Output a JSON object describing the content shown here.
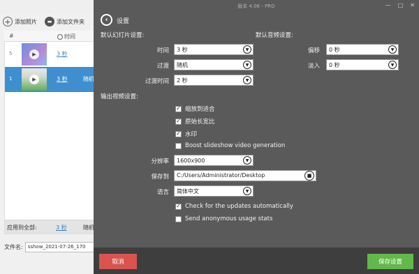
{
  "window": {
    "title": "版本 4.06 - PRO",
    "controls": [
      "—",
      "□",
      "✕"
    ]
  },
  "background": {
    "toolbar": {
      "add_photos": "添加照片",
      "add_folder": "添加文件夹"
    },
    "list_header": {
      "number": "#",
      "time": "时间"
    },
    "rows": [
      {
        "num": "5",
        "duration": "3 秒",
        "transition": ""
      },
      {
        "num": "1",
        "duration": "3 秒",
        "transition": "随机"
      }
    ],
    "footer": {
      "apply_all": "应用到全部:",
      "duration": "3 秒",
      "transition": "随机"
    },
    "filename": {
      "label": "文件名:",
      "value": "sshow_2021-07-26_170"
    }
  },
  "settings": {
    "title": "设置",
    "slideshow_section": "默认幻灯片设置:",
    "audio_section": "默认音频设置:",
    "time_label": "时间",
    "time_value": "3 秒",
    "transition_label": "过渡",
    "transition_value": "随机",
    "transition_time_label": "过渡时间",
    "transition_time_value": "2 秒",
    "offset_label": "偏移",
    "offset_value": "0 秒",
    "fadein_label": "淡入",
    "fadein_value": "0 秒",
    "output_section": "输出视频设置:",
    "checkboxes": [
      {
        "label": "缩放到适合",
        "checked": true
      },
      {
        "label": "原始长宽比",
        "checked": true
      },
      {
        "label": "水印",
        "checked": true
      },
      {
        "label": "Boost slideshow video generation",
        "checked": false
      }
    ],
    "resolution_label": "分辨率",
    "resolution_value": "1600x900",
    "save_to_label": "保存到",
    "save_to_value": "C:/Users/Administrator/Desktop",
    "language_label": "语言",
    "language_value": "简体中文",
    "updates_label": "Check for the updates automatically",
    "updates_checked": true,
    "stats_label": "Send anonymous usage stats",
    "stats_checked": false,
    "cancel_label": "取消",
    "save_label": "保存设置"
  },
  "colors": {
    "overlay": "#5a5a5a",
    "cancel": "#d9534f",
    "save": "#62b84b",
    "selected_row": "#3f8fd0"
  },
  "icons": [
    "back-arrow-icon",
    "dropdown-icon",
    "folder-icon",
    "check-icon",
    "add-icon",
    "clock-icon",
    "play-icon"
  ]
}
